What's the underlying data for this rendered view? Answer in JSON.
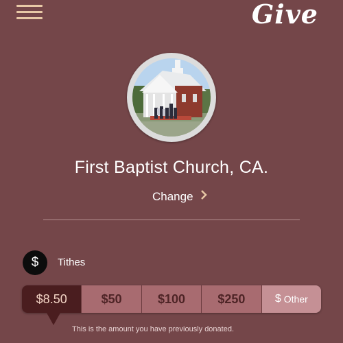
{
  "header": {
    "menu_icon": "hamburger-menu-icon",
    "logo_text": "Give"
  },
  "church": {
    "name": "First Baptist Church, CA.",
    "change_label": "Change",
    "change_icon": "chevron-right-icon"
  },
  "fund": {
    "icon": "dollar-icon",
    "icon_symbol": "$",
    "label": "Tithes"
  },
  "amounts": {
    "options": [
      "$8.50",
      "$50",
      "$100",
      "$250"
    ],
    "selected": "$8.50",
    "other_symbol": "$",
    "other_label": "Other"
  },
  "note": "This is the amount you have previously donated.",
  "colors": {
    "background": "#744649",
    "selected_amount": "#4a1d1f",
    "amount_button": "#a86b70",
    "other_button": "#c59095",
    "menu_accent": "#e8c9a6"
  }
}
